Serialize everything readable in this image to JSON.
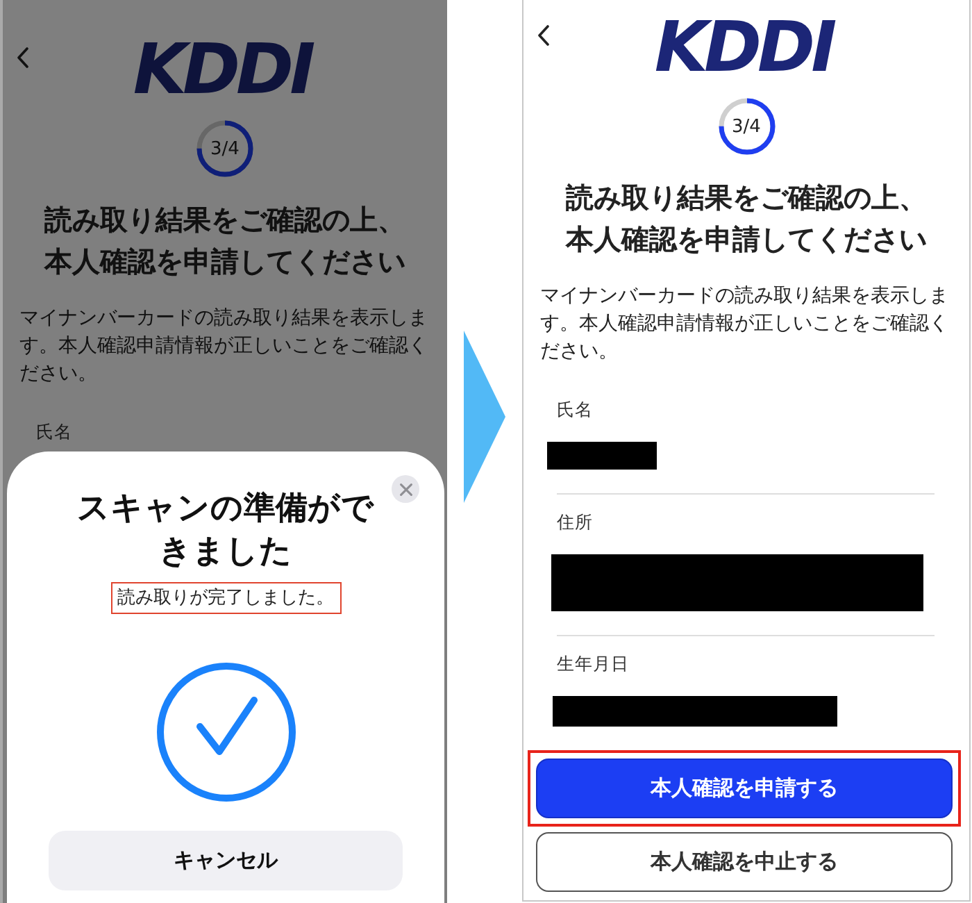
{
  "left_screen": {
    "logo": "KDDI",
    "progress": {
      "label": "3/4",
      "level": 0.75
    },
    "title": "読み取り結果をご確認の上、本人確認を申請してください",
    "description": "マイナンバーカードの読み取り結果を表示します。本人確認申請情報が正しいことをご確認ください。",
    "fields": [
      {
        "label": "氏名"
      }
    ],
    "dimmed": true,
    "sheet": {
      "title": "スキャンの準備ができました",
      "message": {
        "text": "読み取りが完了しました。",
        "highlighted": true
      },
      "cancel_button": "キャンセル"
    }
  },
  "right_screen": {
    "logo": "KDDI",
    "progress": {
      "label": "3/4",
      "level": 0.75
    },
    "title": "読み取り結果をご確認の上、本人確認を申請してください",
    "description": "マイナンバーカードの読み取り結果を表示します。本人確認申請情報が正しいことをご確認ください。",
    "fields": [
      {
        "label": "氏名",
        "redacted": true
      },
      {
        "label": "住所",
        "redacted": true
      },
      {
        "label": "生年月日",
        "redacted": true
      }
    ],
    "buttons": [
      {
        "kind": "primary",
        "label": "本人確認を申請する",
        "highlighted": true
      },
      {
        "kind": "secondary",
        "label": "本人確認を中止する",
        "highlighted": false
      }
    ]
  }
}
